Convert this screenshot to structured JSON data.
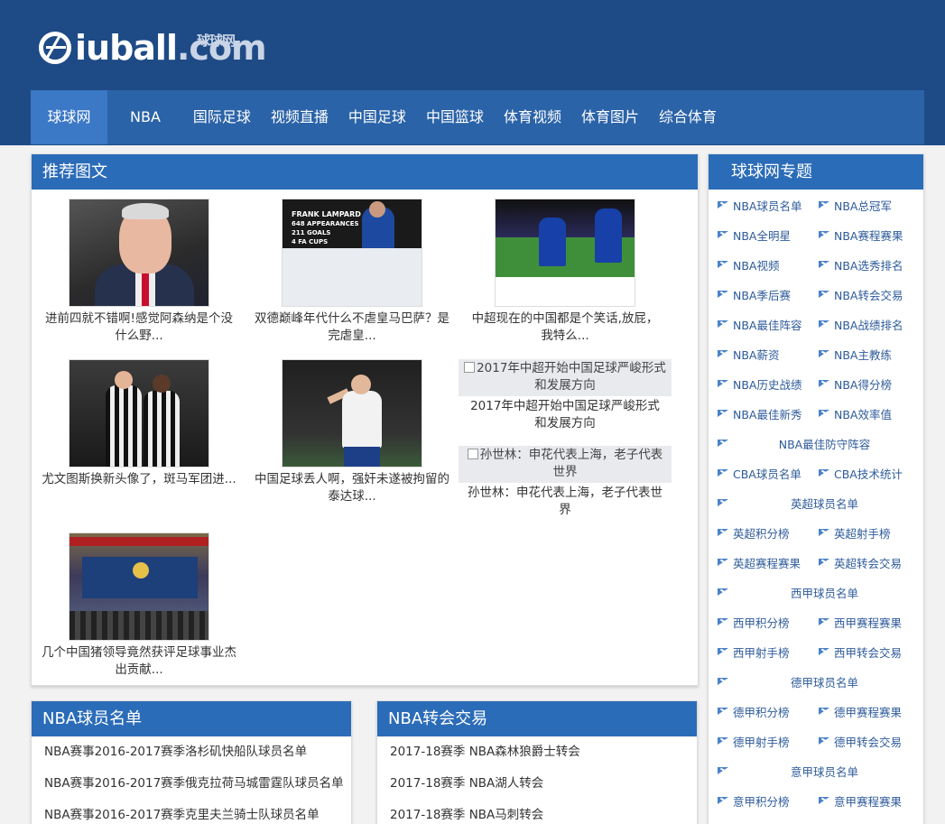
{
  "header": {
    "logo_text": "iuball",
    "logo_domain": ".com",
    "logo_cn": "球球网"
  },
  "nav": {
    "items": [
      {
        "label": "球球网",
        "active": true
      },
      {
        "label": "NBA"
      },
      {
        "label": "国际足球"
      },
      {
        "label": "视频直播"
      },
      {
        "label": "中国足球"
      },
      {
        "label": "中国篮球"
      },
      {
        "label": "体育视频"
      },
      {
        "label": "体育图片"
      },
      {
        "label": "综合体育"
      }
    ]
  },
  "recommend": {
    "title": "推荐图文",
    "cards": [
      {
        "caption": "进前四就不错啊!感觉阿森纳是个没什么野..."
      },
      {
        "caption": "双德巅峰年代什么不虐皇马巴萨？是完虐皇...",
        "thumb_text": [
          "FRANK LAMPARD",
          "648 APPEARANCES",
          "211 GOALS",
          "4 FA CUPS"
        ]
      },
      {
        "caption": "中超现在的中国都是个笑话,放屁，我特么..."
      },
      {
        "caption": "尤文图斯换新头像了，斑马军团进..."
      },
      {
        "caption": "中国足球丢人啊，强奸未遂被拘留的泰达球..."
      },
      {
        "caption": "几个中国猪领导竟然获评足球事业杰出贡献..."
      }
    ],
    "broken": [
      {
        "alt": "2017年中超开始中国足球严峻形式和发展方向",
        "caption": "2017年中超开始中国足球严峻形式和发展方向"
      },
      {
        "alt": "孙世林：申花代表上海，老子代表世界",
        "caption": "孙世林：申花代表上海，老子代表世界"
      }
    ]
  },
  "sidebar": {
    "title": "球球网专题",
    "rows": [
      [
        "NBA球员名单",
        "NBA总冠军"
      ],
      [
        "NBA全明星",
        "NBA赛程赛果"
      ],
      [
        "NBA视频",
        "NBA选秀排名"
      ],
      [
        "NBA季后赛",
        "NBA转会交易"
      ],
      [
        "NBA最佳阵容",
        "NBA战绩排名"
      ],
      [
        "NBA薪资",
        "NBA主教练"
      ],
      [
        "NBA历史战绩",
        "NBA得分榜"
      ],
      [
        "NBA最佳新秀",
        "NBA效率值"
      ],
      [
        "NBA最佳防守阵容"
      ],
      [
        "CBA球员名单",
        "CBA技术统计"
      ],
      [
        "英超球员名单"
      ],
      [
        "英超积分榜",
        "英超射手榜"
      ],
      [
        "英超赛程赛果",
        "英超转会交易"
      ],
      [
        "西甲球员名单"
      ],
      [
        "西甲积分榜",
        "西甲赛程赛果"
      ],
      [
        "西甲射手榜",
        "西甲转会交易"
      ],
      [
        "德甲球员名单"
      ],
      [
        "德甲积分榜",
        "德甲赛程赛果"
      ],
      [
        "德甲射手榜",
        "德甲转会交易"
      ],
      [
        "意甲球员名单"
      ],
      [
        "意甲积分榜",
        "意甲赛程赛果"
      ]
    ]
  },
  "nba_roster": {
    "title": "NBA球员名单",
    "items": [
      "NBA赛事2016-2017赛季洛杉矶快船队球员名单",
      "NBA赛事2016-2017赛季俄克拉荷马城雷霆队球员名单",
      "NBA赛事2016-2017赛季克里夫兰骑士队球员名单"
    ]
  },
  "nba_transfer": {
    "title": "NBA转会交易",
    "items": [
      "2017-18赛季 NBA森林狼爵士转会",
      "2017-18赛季 NBA湖人转会",
      "2017-18赛季 NBA马刺转会"
    ]
  }
}
